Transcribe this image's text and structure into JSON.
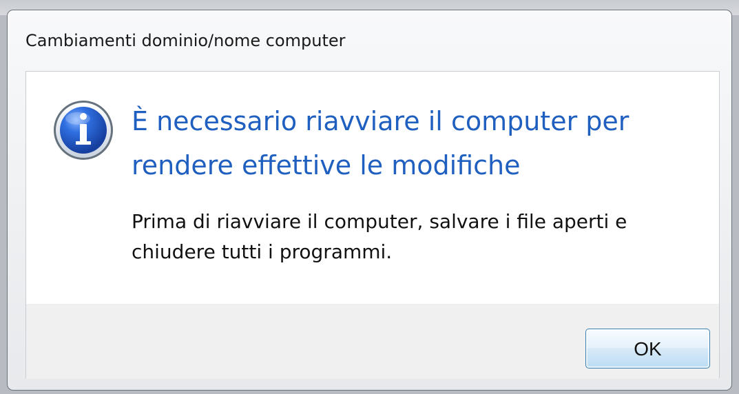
{
  "dialog": {
    "title": "Cambiamenti dominio/nome computer",
    "heading": "È necessario riavviare il computer per\nrendere effettive le modifiche",
    "body": "Prima di riavviare il computer, salvare i file aperti e\nchiudere tutti i programmi.",
    "icon": "info-icon"
  },
  "buttons": {
    "ok_label": "OK"
  },
  "colors": {
    "heading_blue": "#1f5fbf",
    "icon_blue": "#1f4fbf",
    "button_border": "#3c7fb1"
  }
}
